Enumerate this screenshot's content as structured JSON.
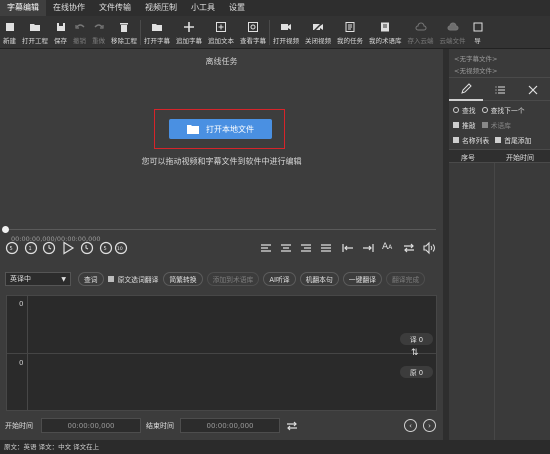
{
  "menu": [
    "字幕编辑",
    "在线协作",
    "文件传输",
    "视频压制",
    "小工具",
    "设置"
  ],
  "toolbar": [
    {
      "label": "新建",
      "icon": "new-file-icon",
      "dim": false
    },
    {
      "label": "打开工程",
      "icon": "open-project-icon",
      "dim": false
    },
    {
      "label": "保存",
      "icon": "save-icon",
      "dim": false
    },
    {
      "label": "撤销",
      "icon": "undo-icon",
      "dim": true
    },
    {
      "label": "重做",
      "icon": "redo-icon",
      "dim": true
    },
    {
      "label": "移除工程",
      "icon": "trash-icon",
      "dim": false
    },
    {
      "label": "打开字幕",
      "icon": "open-subtitle-icon",
      "dim": false
    },
    {
      "label": "追加字幕",
      "icon": "plus-icon",
      "dim": false
    },
    {
      "label": "追加文本",
      "icon": "append-text-icon",
      "dim": false
    },
    {
      "label": "查看字幕",
      "icon": "view-subtitle-icon",
      "dim": false
    },
    {
      "label": "打开视频",
      "icon": "video-icon",
      "dim": false
    },
    {
      "label": "关闭视频",
      "icon": "close-video-icon",
      "dim": false
    },
    {
      "label": "我的任务",
      "icon": "tasks-icon",
      "dim": false
    },
    {
      "label": "我的术语库",
      "icon": "glossary-icon",
      "dim": false
    },
    {
      "label": "存入云端",
      "icon": "cloud-upload-icon",
      "dim": true
    },
    {
      "label": "云端文件",
      "icon": "cloud-files-icon",
      "dim": true
    },
    {
      "label": "导",
      "icon": "export-icon",
      "dim": false
    }
  ],
  "video": {
    "title": "离线任务",
    "open_button": "打开本地文件",
    "hint": "您可以拖动视频和字幕文件到软件中进行编辑",
    "timecode": "00:00:00,000/00:00:00,000"
  },
  "translate": {
    "language": "英译中",
    "buttons": [
      "查词"
    ],
    "checkbox": "原文选词翻译",
    "buttons2": [
      "简繁转换",
      "添加到术语库",
      "AI听译",
      "机翻本句",
      "一键翻译",
      "翻译完成"
    ],
    "dim": [
      "添加到术语库",
      "翻译完成"
    ]
  },
  "editor": {
    "line1": "0",
    "line2": "0",
    "trans_badge": "译 0",
    "orig_badge": "原 0"
  },
  "times": {
    "start_label": "开始时间",
    "start_value": "00:00:00,000",
    "end_label": "结束时间",
    "end_value": "00:00:00,000"
  },
  "status": "原文：英语  译文：中文    译文在上",
  "right": {
    "file1": "<无字幕文件>",
    "file2": "<无视频文件>",
    "find": "查找",
    "find_next": "查找下一个",
    "sort": "推敲",
    "glossary": "术语库",
    "names": "名称列表",
    "header_add": "首尾添加",
    "col_index": "序号",
    "col_start": "开始时间"
  }
}
